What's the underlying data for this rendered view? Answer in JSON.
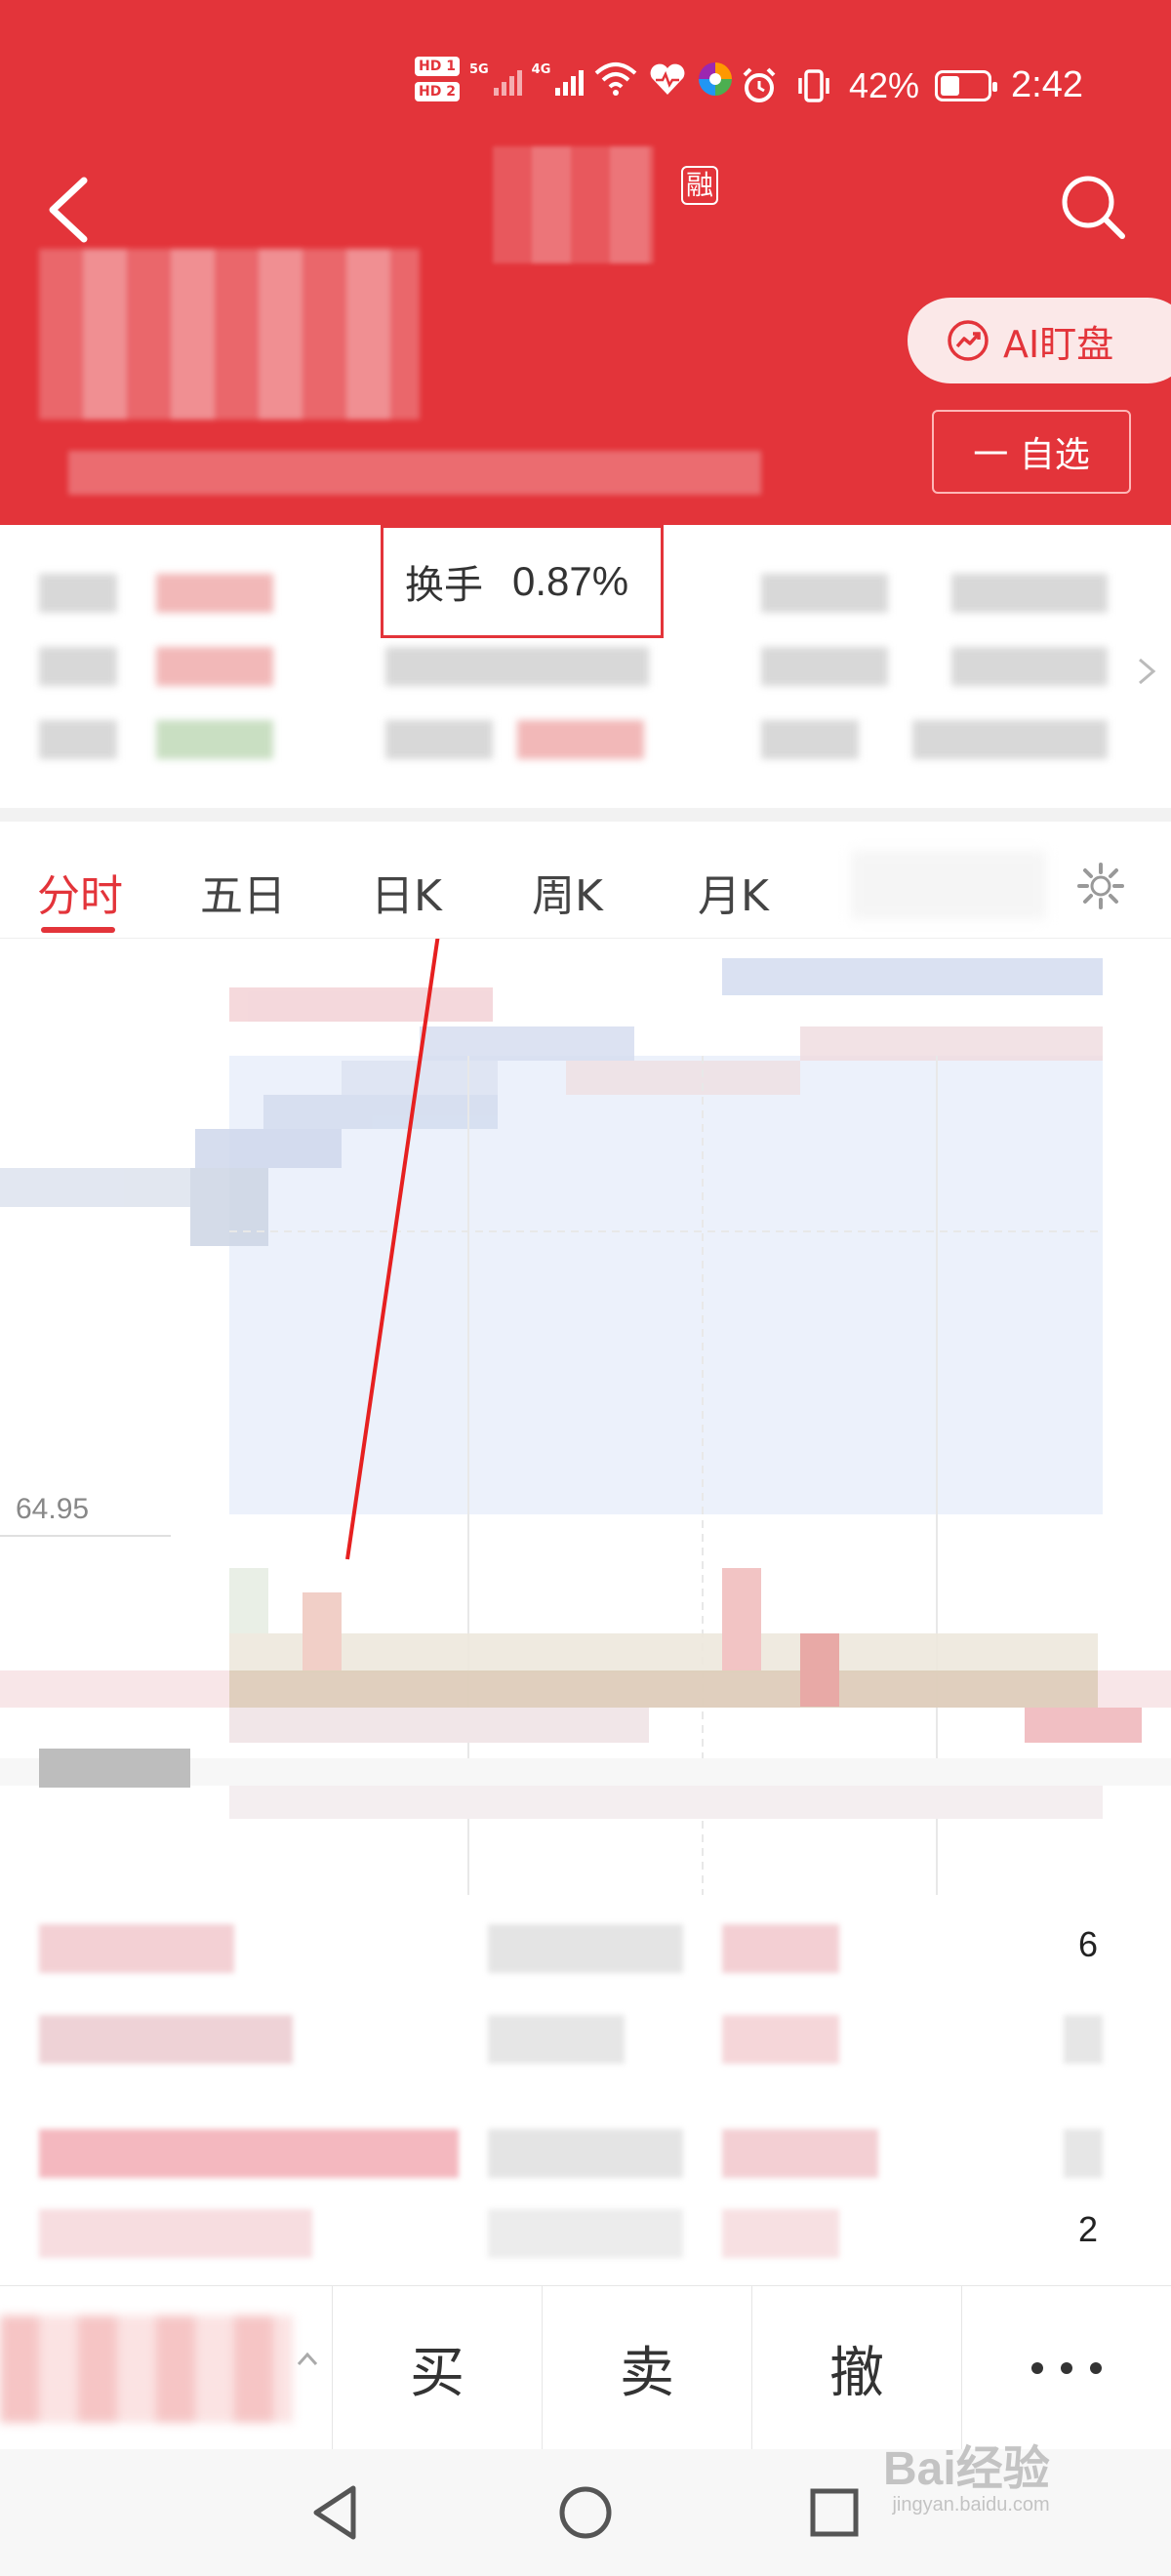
{
  "status_bar": {
    "sim_badges": [
      "HD 1",
      "HD 2"
    ],
    "network_labels": [
      "5G",
      "4G"
    ],
    "battery_text": "42%",
    "battery_level": 0.42,
    "time": "2:42",
    "icons": [
      "wifi-icon",
      "heart-rate-icon",
      "color-wheel-app-icon",
      "alarm-icon",
      "vibrate-icon",
      "battery-icon"
    ]
  },
  "header": {
    "back_icon": "chevron-left-icon",
    "margin_badge": "融",
    "search_icon": "search-icon",
    "ai_button_label": "AI盯盘",
    "watchlist_button_label": "一 自选",
    "colors": {
      "brand_red": "#e3343a",
      "rise_red": "#e3343a",
      "fall_green": "#3a9a3a"
    }
  },
  "quote": {
    "turnover_label": "换手",
    "turnover_value": "0.87%",
    "highlight_color": "#e3343a"
  },
  "tabs": [
    {
      "label": "分时",
      "active": true
    },
    {
      "label": "五日",
      "active": false
    },
    {
      "label": "日K",
      "active": false
    },
    {
      "label": "周K",
      "active": false
    },
    {
      "label": "月K",
      "active": false
    }
  ],
  "chart": {
    "price_axis_label": "64.95"
  },
  "orderbook": {
    "visible_numbers": [
      "6",
      "2"
    ]
  },
  "trade_bar": {
    "buy_label": "买",
    "sell_label": "卖",
    "cancel_label": "撤",
    "more_icon": "more-dots-icon"
  },
  "nav_bar": {
    "icons": [
      "back-triangle-icon",
      "home-circle-icon",
      "recents-square-icon"
    ]
  },
  "watermark": {
    "brand": "Bai经验",
    "domain": "jingyan.baidu.com"
  }
}
